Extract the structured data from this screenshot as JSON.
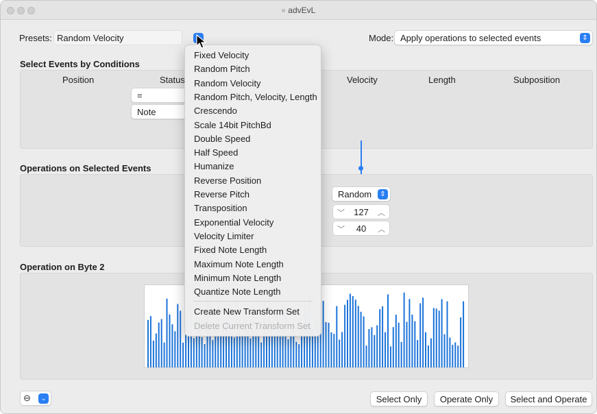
{
  "window": {
    "title": "advEvL"
  },
  "presets": {
    "label": "Presets:",
    "value": "Random Velocity"
  },
  "mode": {
    "label": "Mode:",
    "value": "Apply operations to selected events"
  },
  "select_section": {
    "title": "Select Events by Conditions",
    "columns": {
      "position": "Position",
      "status": "Status",
      "velocity": "Velocity",
      "length": "Length",
      "subposition": "Subposition"
    },
    "status_operator": "=",
    "status_value": "Note"
  },
  "operations_section": {
    "title": "Operations on Selected Events",
    "velocity_operation": "Random",
    "value1": "127",
    "value2": "40"
  },
  "byte2_section": {
    "title": "Operation on Byte 2",
    "bar_color": "#1a73d9"
  },
  "buttons": {
    "select_only": "Select Only",
    "operate_only": "Operate Only",
    "select_and_operate": "Select and Operate"
  },
  "menu": {
    "items": [
      "Fixed Velocity",
      "Random Pitch",
      "Random Velocity",
      "Random Pitch, Velocity, Length",
      "Crescendo",
      "Scale 14bit PitchBd",
      "Double Speed",
      "Half Speed",
      "Humanize",
      "Reverse Position",
      "Reverse Pitch",
      "Transposition",
      "Exponential Velocity",
      "Velocity Limiter",
      "Fixed Note Length",
      "Maximum Note Length",
      "Minimum Note Length",
      "Quantize Note Length"
    ],
    "create_set": "Create New Transform Set",
    "delete_set": "Delete Current Transform Set"
  },
  "accent_color": "#2a7ff2"
}
